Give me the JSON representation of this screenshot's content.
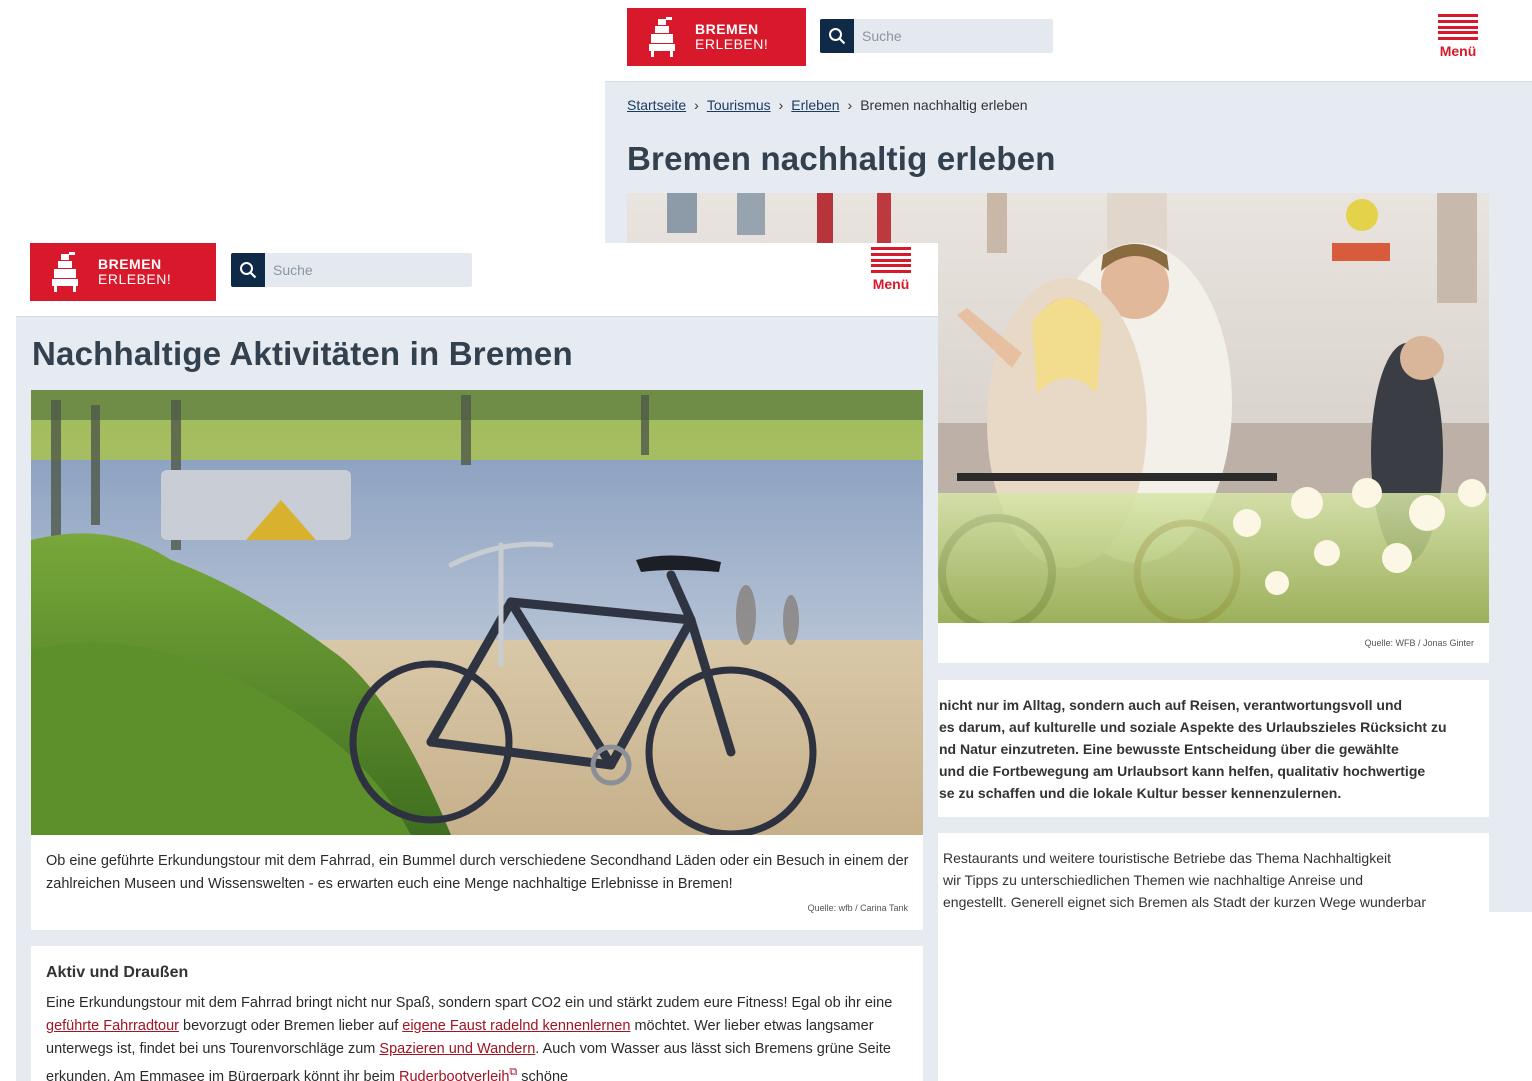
{
  "back_page": {
    "logo": {
      "line1": "BREMEN",
      "line2": "ERLEBEN!"
    },
    "search": {
      "placeholder": "Suche"
    },
    "menu_label": "Menü",
    "breadcrumb": [
      {
        "label": "Startseite"
      },
      {
        "label": "Tourismus"
      },
      {
        "label": "Erleben"
      },
      {
        "label": "Bremen nachhaltig erleben"
      }
    ],
    "title": "Bremen nachhaltig erleben",
    "image_credit": "Quelle: WFB / Jonas Ginter",
    "intro_lines": [
      "nicht nur im Alltag, sondern auch auf Reisen, verantwortungsvoll und",
      "es darum, auf kulturelle und soziale Aspekte des Urlaubszieles Rücksicht zu",
      "nd Natur einzutreten. Eine bewusste Entscheidung über die gewählte",
      "und die Fortbewegung am Urlaubsort kann helfen, qualitativ hochwertige",
      "se zu schaffen und die lokale Kultur besser kennenzulernen."
    ],
    "second_lines": [
      "Restaurants und weitere touristische Betriebe das Thema Nachhaltigkeit",
      "wir Tipps zu unterschiedlichen Themen wie nachhaltige Anreise und",
      "engestellt. Generell eignet sich Bremen als Stadt der kurzen Wege wunderbar"
    ]
  },
  "front_page": {
    "logo": {
      "line1": "BREMEN",
      "line2": "ERLEBEN!"
    },
    "search": {
      "placeholder": "Suche"
    },
    "menu_label": "Menü",
    "title": "Nachhaltige Aktivitäten in Bremen",
    "intro": "Ob eine geführte Erkundungstour mit dem Fahrrad, ein Bummel durch verschiedene Secondhand Läden oder ein Besuch in einem der zahlreichen Museen und Wissenswelten - es erwarten euch eine Menge nachhaltige Erlebnisse in Bremen!",
    "image_credit": "Quelle: wfb / Carina Tank",
    "section": {
      "heading": "Aktiv und Draußen",
      "t1": "Eine Erkundungstour mit dem Fahrrad bringt nicht nur Spaß, sondern spart CO2 ein und stärkt zudem eure Fitness! Egal ob ihr eine ",
      "link1": "geführte Fahrradtour",
      "t2": " bevorzugt oder Bremen lieber auf ",
      "link2": "eigene Faust radelnd kennenlernen",
      "t3": " möchtet. Wer lieber etwas langsamer unterwegs ist, findet bei uns Tourenvorschläge zum ",
      "link3": "Spazieren und Wandern",
      "t4": ". Auch vom Wasser aus lässt sich Bremens grüne Seite erkunden. Am Emmasee im Bürgerpark könnt ihr beim ",
      "link4": "Ruderbootverleih",
      "t5": " schöne"
    }
  },
  "colors": {
    "brand_red": "#d7192b",
    "navy": "#0e2a47",
    "page_bg": "#e6ebf2",
    "link_red": "#a01423"
  },
  "icons": [
    "bremen-town-musicians-logo-icon",
    "search-icon",
    "hamburger-menu-icon",
    "chevron-right-icon",
    "external-link-icon"
  ]
}
